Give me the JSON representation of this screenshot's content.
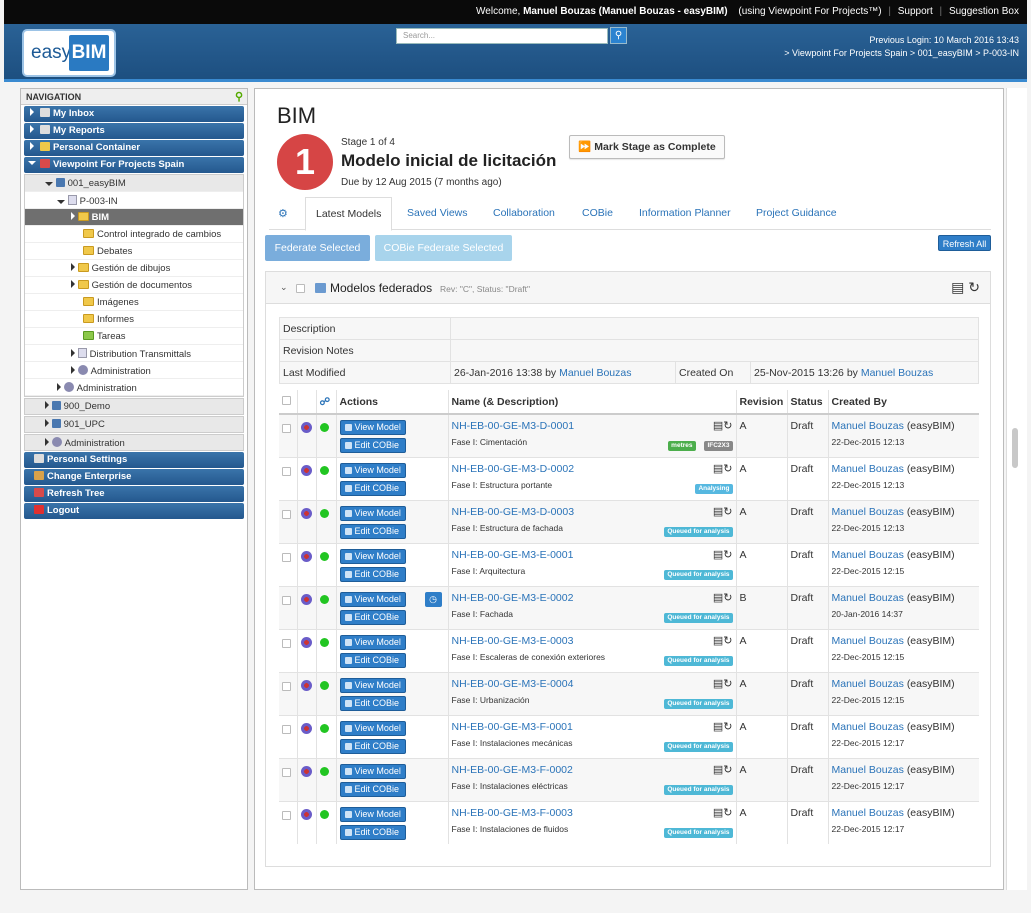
{
  "topbar": {
    "welcome_prefix": "Welcome,",
    "user": "Manuel Bouzas (Manuel Bouzas - easyBIM)",
    "using": "(using Viewpoint For Projects™)",
    "support": "Support",
    "suggestion": "Suggestion Box"
  },
  "header": {
    "logo_easy": "easy",
    "logo_bim": "BIM",
    "search_placeholder": "Search...",
    "previous_login": "Previous Login: 10 March 2016 13:43",
    "breadcrumb": "> Viewpoint For Projects Spain  >  001_easyBIM  >  P-003-IN"
  },
  "nav": {
    "title": "NAVIGATION",
    "top_items": [
      "My Inbox",
      "My Reports",
      "Personal Container",
      "Viewpoint For Projects Spain"
    ],
    "tree": [
      {
        "label": "001_easyBIM",
        "indent": 1
      },
      {
        "label": "P-003-IN",
        "indent": 2
      },
      {
        "label": "BIM",
        "indent": 3
      },
      {
        "label": "Control integrado de cambios",
        "indent": 3
      },
      {
        "label": "Debates",
        "indent": 3
      },
      {
        "label": "Gestión de dibujos",
        "indent": 3
      },
      {
        "label": "Gestión de documentos",
        "indent": 3
      },
      {
        "label": "Imágenes",
        "indent": 3
      },
      {
        "label": "Informes",
        "indent": 3
      },
      {
        "label": "Tareas",
        "indent": 3
      },
      {
        "label": "Distribution Transmittals",
        "indent": 3
      },
      {
        "label": "Administration",
        "indent": 3
      },
      {
        "label": "Administration",
        "indent": 2
      }
    ],
    "grey_items": [
      "900_Demo",
      "901_UPC",
      "Administration"
    ],
    "bottom_items": [
      "Personal Settings",
      "Change Enterprise",
      "Refresh Tree",
      "Logout"
    ]
  },
  "main": {
    "title": "BIM",
    "stage_number": "1",
    "stage_of": "Stage 1 of 4",
    "stage_name": "Modelo inicial de licitación",
    "stage_due": "Due by 12 Aug 2015 (7 months ago)",
    "mark_complete": "Mark Stage as Complete",
    "tabs": [
      "Latest Models",
      "Saved Views",
      "Collaboration",
      "COBie",
      "Information Planner",
      "Project Guidance"
    ],
    "federate_selected": "Federate Selected",
    "cobie_federate_selected": "COBie Federate Selected",
    "refresh_all": "Refresh All"
  },
  "panel": {
    "title": "Modelos federados",
    "meta": "Rev: \"C\",  Status: \"Draft\"",
    "description_label": "Description",
    "revision_notes_label": "Revision Notes",
    "last_modified_label": "Last Modified",
    "last_modified_value": "26-Jan-2016 13:38 by",
    "last_modified_by": "Manuel Bouzas",
    "created_on_label": "Created On",
    "created_on_value": "25-Nov-2015 13:26 by",
    "created_on_by": "Manuel Bouzas"
  },
  "models": {
    "headers": {
      "actions": "Actions",
      "name": "Name (& Description)",
      "revision": "Revision",
      "status": "Status",
      "created_by": "Created By"
    },
    "view_model": "View Model",
    "edit_cobie": "Edit COBie",
    "rows": [
      {
        "name": "NH-EB-00-GE-M3-D-0001",
        "desc": "Fase I: Cimentación",
        "rev": "A",
        "status": "Draft",
        "user": "Manuel Bouzas",
        "org": "(easyBIM)",
        "date": "22-Dec-2015 12:13",
        "badges": [
          "metres",
          "IFC2X3"
        ]
      },
      {
        "name": "NH-EB-00-GE-M3-D-0002",
        "desc": "Fase I: Estructura portante",
        "rev": "A",
        "status": "Draft",
        "user": "Manuel Bouzas",
        "org": "(easyBIM)",
        "date": "22-Dec-2015 12:13",
        "badges": [
          "Analysing"
        ]
      },
      {
        "name": "NH-EB-00-GE-M3-D-0003",
        "desc": "Fase I: Estructura de fachada",
        "rev": "A",
        "status": "Draft",
        "user": "Manuel Bouzas",
        "org": "(easyBIM)",
        "date": "22-Dec-2015 12:13",
        "badges": [
          "Queued for analysis"
        ]
      },
      {
        "name": "NH-EB-00-GE-M3-E-0001",
        "desc": "Fase I: Arquitectura",
        "rev": "A",
        "status": "Draft",
        "user": "Manuel Bouzas",
        "org": "(easyBIM)",
        "date": "22-Dec-2015 12:15",
        "badges": [
          "Queued for analysis"
        ]
      },
      {
        "name": "NH-EB-00-GE-M3-E-0002",
        "desc": "Fase I: Fachada",
        "rev": "B",
        "status": "Draft",
        "user": "Manuel Bouzas",
        "org": "(easyBIM)",
        "date": "20-Jan-2016 14:37",
        "badges": [
          "Queued for analysis"
        ],
        "clock": true
      },
      {
        "name": "NH-EB-00-GE-M3-E-0003",
        "desc": "Fase I: Escaleras de conexión exteriores",
        "rev": "A",
        "status": "Draft",
        "user": "Manuel Bouzas",
        "org": "(easyBIM)",
        "date": "22-Dec-2015 12:15",
        "badges": [
          "Queued for analysis"
        ]
      },
      {
        "name": "NH-EB-00-GE-M3-E-0004",
        "desc": "Fase I: Urbanización",
        "rev": "A",
        "status": "Draft",
        "user": "Manuel Bouzas",
        "org": "(easyBIM)",
        "date": "22-Dec-2015 12:15",
        "badges": [
          "Queued for analysis"
        ]
      },
      {
        "name": "NH-EB-00-GE-M3-F-0001",
        "desc": "Fase I: Instalaciones mecánicas",
        "rev": "A",
        "status": "Draft",
        "user": "Manuel Bouzas",
        "org": "(easyBIM)",
        "date": "22-Dec-2015 12:17",
        "badges": [
          "Queued for analysis"
        ]
      },
      {
        "name": "NH-EB-00-GE-M3-F-0002",
        "desc": "Fase I: Instalaciones eléctricas",
        "rev": "A",
        "status": "Draft",
        "user": "Manuel Bouzas",
        "org": "(easyBIM)",
        "date": "22-Dec-2015 12:17",
        "badges": [
          "Queued for analysis"
        ]
      },
      {
        "name": "NH-EB-00-GE-M3-F-0003",
        "desc": "Fase I: Instalaciones de fluidos",
        "rev": "A",
        "status": "Draft",
        "user": "Manuel Bouzas",
        "org": "(easyBIM)",
        "date": "22-Dec-2015 12:17",
        "badges": [
          "Queued for analysis"
        ]
      }
    ]
  },
  "colors": {
    "brand_blue": "#2a6296",
    "button_blue": "#2f7ec8",
    "stage_red": "#d64545",
    "status_green": "#22c522"
  }
}
